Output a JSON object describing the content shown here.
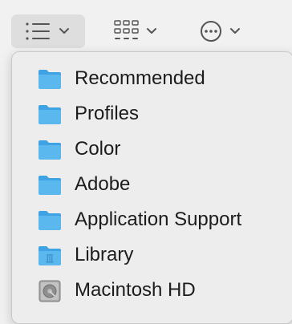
{
  "toolbar": {
    "list_view_button": {
      "icon": "list-view-icon",
      "active": true
    },
    "icon_view_button": {
      "icon": "grid-view-icon"
    },
    "more_button": {
      "icon": "ellipsis-circle-icon"
    }
  },
  "menu": {
    "items": [
      {
        "label": "Recommended",
        "icon": "folder-icon"
      },
      {
        "label": "Profiles",
        "icon": "folder-icon"
      },
      {
        "label": "Color",
        "icon": "folder-icon"
      },
      {
        "label": "Adobe",
        "icon": "folder-icon"
      },
      {
        "label": "Application Support",
        "icon": "folder-icon"
      },
      {
        "label": "Library",
        "icon": "library-folder-icon"
      },
      {
        "label": "Macintosh HD",
        "icon": "hard-drive-icon"
      }
    ]
  },
  "colors": {
    "folder_blue": "#5ab8ee",
    "folder_blue_dark": "#3fa3e3",
    "active_button_bg": "#dedede",
    "text": "#1c1c1c"
  }
}
